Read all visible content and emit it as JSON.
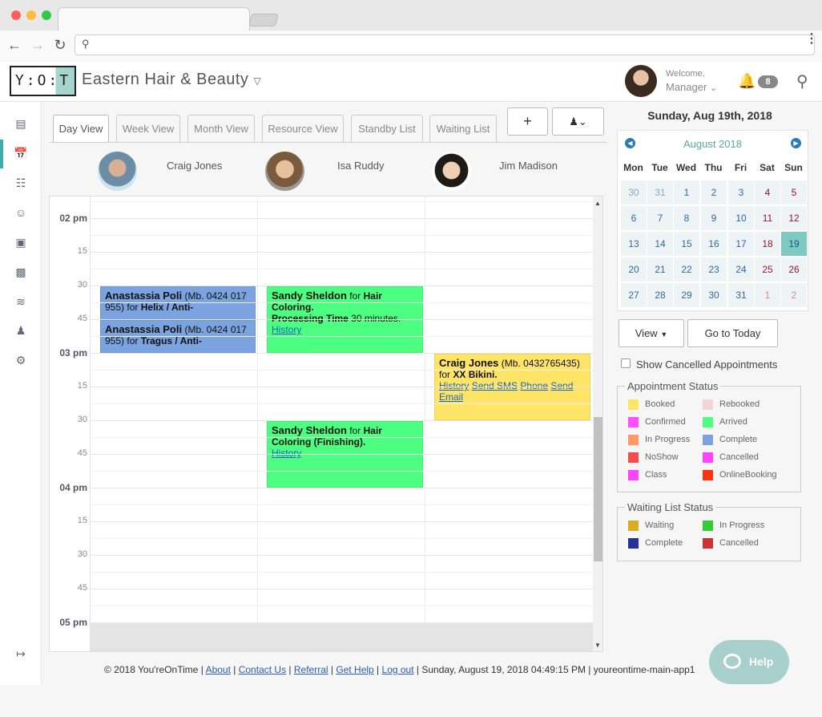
{
  "browser": {
    "url": ""
  },
  "header": {
    "logo": "Y:O:T",
    "business_name": "Eastern Hair & Beauty",
    "welcome": "Welcome,",
    "user_role": "Manager",
    "notification_count": "8"
  },
  "sidebar": {
    "items": [
      "dashboard-icon",
      "calendar-icon",
      "receipt-icon",
      "clients-icon",
      "inbox-icon",
      "invoice-icon",
      "reports-icon",
      "staff-icon",
      "settings-icon",
      "logout-icon"
    ]
  },
  "tabs": [
    "Day View",
    "Week View",
    "Month View",
    "Resource View",
    "Standby List",
    "Waiting List"
  ],
  "active_tab": "Day View",
  "actions": {
    "add": "+",
    "staff_filter": "person-icon"
  },
  "resources": [
    "Craig Jones",
    "Isa Ruddy",
    "Jim Madison"
  ],
  "times": [
    {
      "label": "02 pm",
      "hour": true
    },
    {
      "label": "15",
      "hour": false
    },
    {
      "label": "30",
      "hour": false
    },
    {
      "label": "45",
      "hour": false
    },
    {
      "label": "03 pm",
      "hour": true
    },
    {
      "label": "15",
      "hour": false
    },
    {
      "label": "30",
      "hour": false
    },
    {
      "label": "45",
      "hour": false
    },
    {
      "label": "04 pm",
      "hour": true
    },
    {
      "label": "15",
      "hour": false
    },
    {
      "label": "30",
      "hour": false
    },
    {
      "label": "45",
      "hour": false
    },
    {
      "label": "05 pm",
      "hour": true
    }
  ],
  "appointments": [
    {
      "name": "Anastassia Poli",
      "mb": "(Mb. 0424 017 955)",
      "for": "for",
      "service": "Helix / Anti-"
    },
    {
      "name": "Anastassia Poli",
      "mb": "(Mb. 0424 017 955)",
      "for": "for",
      "service": "Tragus / Anti-"
    },
    {
      "name": "Sandy Sheldon",
      "for": "for",
      "service": "Hair Coloring",
      "extra_label": "Processing Time",
      "extra_value": "30 minutes.",
      "link": "History"
    },
    {
      "name": "Craig Jones",
      "mb": "(Mb. 0432765435)",
      "for": "for",
      "service": "XX Bikini",
      "links": [
        "History",
        "Send SMS",
        "Phone",
        "Send Email"
      ]
    },
    {
      "name": "Sandy Sheldon",
      "for": "for",
      "service": "Hair Coloring (Finishing)",
      "link": "History"
    }
  ],
  "calendar": {
    "selected_date_heading": "Sunday, Aug 19th, 2018",
    "month": "August 2018",
    "weekdays": [
      "Mon",
      "Tue",
      "Wed",
      "Thu",
      "Fri",
      "Sat",
      "Sun"
    ],
    "weeks": [
      [
        "30",
        "31",
        "1",
        "2",
        "3",
        "4",
        "5"
      ],
      [
        "6",
        "7",
        "8",
        "9",
        "10",
        "11",
        "12"
      ],
      [
        "13",
        "14",
        "15",
        "16",
        "17",
        "18",
        "19"
      ],
      [
        "20",
        "21",
        "22",
        "23",
        "24",
        "25",
        "26"
      ],
      [
        "27",
        "28",
        "29",
        "30",
        "31",
        "1",
        "2"
      ]
    ],
    "selected_day": "19"
  },
  "view_button": "View",
  "go_today": "Go to Today",
  "show_cancelled": "Show Cancelled Appointments",
  "appointment_status": {
    "title": "Appointment Status",
    "items": [
      {
        "label": "Booked",
        "color": "#ffe466"
      },
      {
        "label": "Rebooked",
        "color": "#f4d4d4"
      },
      {
        "label": "Confirmed",
        "color": "#ff4dff"
      },
      {
        "label": "Arrived",
        "color": "#4cff80"
      },
      {
        "label": "In Progress",
        "color": "#ff9966"
      },
      {
        "label": "Complete",
        "color": "#7ba3e0"
      },
      {
        "label": "NoShow",
        "color": "#f24d4d"
      },
      {
        "label": "Cancelled",
        "color": "#ff44ff"
      },
      {
        "label": "Class",
        "color": "#ff44ff"
      },
      {
        "label": "OnlineBooking",
        "color": "#ff3311"
      }
    ]
  },
  "waiting_status": {
    "title": "Waiting List Status",
    "items": [
      {
        "label": "Waiting",
        "color": "#ddaa22"
      },
      {
        "label": "In Progress",
        "color": "#33cc33"
      },
      {
        "label": "Complete",
        "color": "#223399"
      },
      {
        "label": "Cancelled",
        "color": "#cc3333"
      }
    ]
  },
  "footer": {
    "copyright": "© 2018 You'reOnTime |",
    "links": [
      "About",
      "Contact Us",
      "Referral",
      "Get Help",
      "Log out"
    ],
    "timestamp": "| Sunday, August 19, 2018  04:49:15 PM | youreontime-main-app1"
  },
  "help_label": "Help"
}
